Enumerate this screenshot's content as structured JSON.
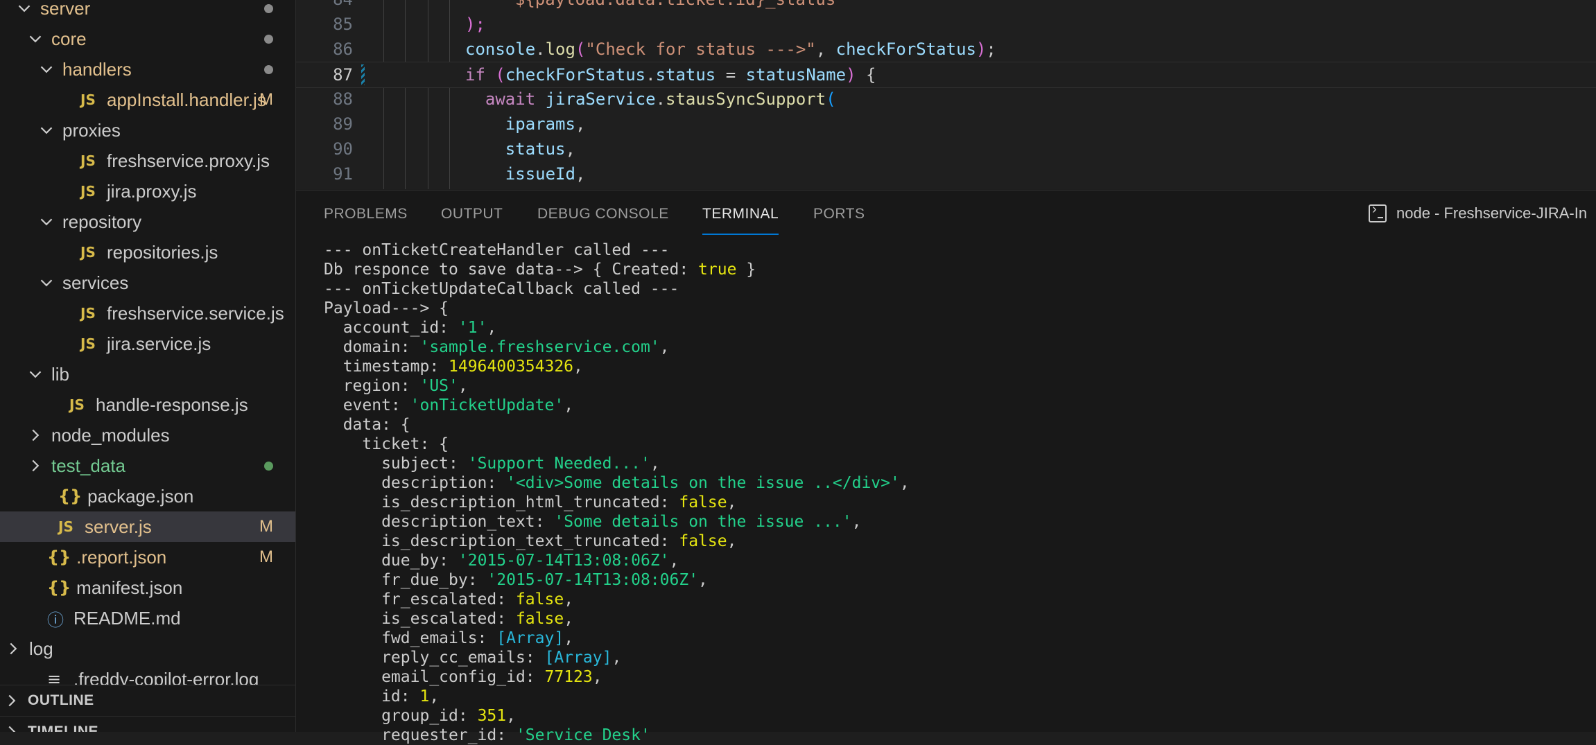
{
  "explorer": {
    "rows": [
      {
        "label": "server",
        "indent": 1,
        "chevron": "down",
        "icon": "",
        "color": "yellow",
        "mark": "dot-gray"
      },
      {
        "label": "core",
        "indent": 2,
        "chevron": "down",
        "icon": "",
        "color": "yellow",
        "mark": "dot-gray"
      },
      {
        "label": "handlers",
        "indent": 3,
        "chevron": "down",
        "icon": "",
        "color": "yellow",
        "mark": "dot-gray"
      },
      {
        "label": "appInstall.handler.js",
        "indent": 4,
        "chevron": "",
        "icon": "JS",
        "color": "yellow",
        "mark": "M"
      },
      {
        "label": "proxies",
        "indent": 3,
        "chevron": "down",
        "icon": "",
        "color": "",
        "mark": ""
      },
      {
        "label": "freshservice.proxy.js",
        "indent": 4,
        "chevron": "",
        "icon": "JS",
        "color": "",
        "mark": ""
      },
      {
        "label": "jira.proxy.js",
        "indent": 4,
        "chevron": "",
        "icon": "JS",
        "color": "",
        "mark": ""
      },
      {
        "label": "repository",
        "indent": 3,
        "chevron": "down",
        "icon": "",
        "color": "",
        "mark": ""
      },
      {
        "label": "repositories.js",
        "indent": 4,
        "chevron": "",
        "icon": "JS",
        "color": "",
        "mark": ""
      },
      {
        "label": "services",
        "indent": 3,
        "chevron": "down",
        "icon": "",
        "color": "",
        "mark": ""
      },
      {
        "label": "freshservice.service.js",
        "indent": 4,
        "chevron": "",
        "icon": "JS",
        "color": "",
        "mark": ""
      },
      {
        "label": "jira.service.js",
        "indent": 4,
        "chevron": "",
        "icon": "JS",
        "color": "",
        "mark": ""
      },
      {
        "label": "lib",
        "indent": 2,
        "chevron": "down",
        "icon": "",
        "color": "",
        "mark": ""
      },
      {
        "label": "handle-response.js",
        "indent": 3,
        "chevron": "",
        "icon": "JS",
        "color": "",
        "mark": ""
      },
      {
        "label": "node_modules",
        "indent": 2,
        "chevron": "right",
        "icon": "",
        "color": "",
        "mark": ""
      },
      {
        "label": "test_data",
        "indent": 2,
        "chevron": "right",
        "icon": "",
        "color": "green",
        "mark": "dot-green"
      },
      {
        "label": "package.json",
        "indent": 2,
        "chevron": "",
        "icon": "{}",
        "color": "",
        "mark": ""
      },
      {
        "label": "server.js",
        "indent": 2,
        "chevron": "",
        "icon": "JS",
        "color": "yellow",
        "mark": "M",
        "selected": true
      },
      {
        "label": ".report.json",
        "indent": 1,
        "chevron": "",
        "icon": "{}",
        "color": "yellow",
        "mark": "M"
      },
      {
        "label": "manifest.json",
        "indent": 1,
        "chevron": "",
        "icon": "{}",
        "color": "",
        "mark": ""
      },
      {
        "label": "README.md",
        "indent": 1,
        "chevron": "",
        "icon": "ⓘ",
        "color": "",
        "mark": ""
      },
      {
        "label": "log",
        "indent": 0,
        "chevron": "right",
        "icon": "",
        "color": "",
        "mark": ""
      },
      {
        "label": ".freddy-copilot-error.log",
        "indent": 1,
        "chevron": "",
        "icon": "≡",
        "color": "",
        "mark": ""
      }
    ],
    "outline_label": "OUTLINE",
    "timeline_label": "TIMELINE"
  },
  "editor": {
    "current_line": 87,
    "lines": [
      {
        "num": 84,
        "tokens": [
          [
            "tk-tmpl",
            "  ${payload.data.ticket.id}_status"
          ]
        ]
      },
      {
        "num": 85,
        "tokens": [
          [
            "tk-paren",
            ");"
          ]
        ]
      },
      {
        "num": 86,
        "tokens": [
          [
            "tk-var",
            "console"
          ],
          [
            "tk-punc",
            "."
          ],
          [
            "tk-fn",
            "log"
          ],
          [
            "tk-paren",
            "("
          ],
          [
            "tk-str",
            "\"Check for status --->\""
          ],
          [
            "tk-punc",
            ", "
          ],
          [
            "tk-var",
            "checkForStatus"
          ],
          [
            "tk-paren",
            ")"
          ],
          [
            "tk-punc",
            ";"
          ]
        ]
      },
      {
        "num": 87,
        "tokens": [
          [
            "tk-kw",
            "if"
          ],
          [
            "tk-punc",
            " "
          ],
          [
            "tk-paren",
            "("
          ],
          [
            "tk-var",
            "checkForStatus"
          ],
          [
            "tk-punc",
            "."
          ],
          [
            "tk-var",
            "status"
          ],
          [
            "tk-punc",
            " = "
          ],
          [
            "tk-var",
            "statusName"
          ],
          [
            "tk-paren",
            ")"
          ],
          [
            "tk-punc",
            " {"
          ]
        ]
      },
      {
        "num": 88,
        "tokens": [
          [
            "tk-punc",
            "  "
          ],
          [
            "tk-kw",
            "await"
          ],
          [
            "tk-punc",
            " "
          ],
          [
            "tk-var",
            "jiraService"
          ],
          [
            "tk-punc",
            "."
          ],
          [
            "tk-fn",
            "stausSyncSupport"
          ],
          [
            "tk-paren2",
            "("
          ]
        ]
      },
      {
        "num": 89,
        "tokens": [
          [
            "tk-punc",
            "    "
          ],
          [
            "tk-var",
            "iparams"
          ],
          [
            "tk-punc",
            ","
          ]
        ]
      },
      {
        "num": 90,
        "tokens": [
          [
            "tk-punc",
            "    "
          ],
          [
            "tk-var",
            "status"
          ],
          [
            "tk-punc",
            ","
          ]
        ]
      },
      {
        "num": 91,
        "tokens": [
          [
            "tk-punc",
            "    "
          ],
          [
            "tk-var",
            "issueId"
          ],
          [
            "tk-punc",
            ","
          ]
        ]
      }
    ]
  },
  "panel": {
    "tabs": [
      "PROBLEMS",
      "OUTPUT",
      "DEBUG CONSOLE",
      "TERMINAL",
      "PORTS"
    ],
    "active_tab": "TERMINAL",
    "terminal_title": "node - Freshservice-JIRA-In"
  },
  "terminal": {
    "lines": [
      [
        [
          "",
          "--- onTicketCreateHandler called ---"
        ]
      ],
      [
        [
          "",
          "Db responce to save data--> { Created: "
        ],
        [
          "t-bool",
          "true"
        ],
        [
          "",
          " }"
        ]
      ],
      [
        [
          "",
          "--- onTicketUpdateCallback called ---"
        ]
      ],
      [
        [
          "",
          "Payload---> {"
        ]
      ],
      [
        [
          "",
          "  account_id: "
        ],
        [
          "t-str",
          "'1'"
        ],
        [
          "",
          ","
        ]
      ],
      [
        [
          "",
          "  domain: "
        ],
        [
          "t-str",
          "'sample.freshservice.com'"
        ],
        [
          "",
          ","
        ]
      ],
      [
        [
          "",
          "  timestamp: "
        ],
        [
          "t-num",
          "1496400354326"
        ],
        [
          "",
          ","
        ]
      ],
      [
        [
          "",
          "  region: "
        ],
        [
          "t-str",
          "'US'"
        ],
        [
          "",
          ","
        ]
      ],
      [
        [
          "",
          "  event: "
        ],
        [
          "t-str",
          "'onTicketUpdate'"
        ],
        [
          "",
          ","
        ]
      ],
      [
        [
          "",
          "  data: {"
        ]
      ],
      [
        [
          "",
          "    ticket: {"
        ]
      ],
      [
        [
          "",
          "      subject: "
        ],
        [
          "t-str",
          "'Support Needed...'"
        ],
        [
          "",
          ","
        ]
      ],
      [
        [
          "",
          "      description: "
        ],
        [
          "t-str",
          "'<div>Some details on the issue ..</div>'"
        ],
        [
          "",
          ","
        ]
      ],
      [
        [
          "",
          "      is_description_html_truncated: "
        ],
        [
          "t-bool",
          "false"
        ],
        [
          "",
          ","
        ]
      ],
      [
        [
          "",
          "      description_text: "
        ],
        [
          "t-str",
          "'Some details on the issue ...'"
        ],
        [
          "",
          ","
        ]
      ],
      [
        [
          "",
          "      is_description_text_truncated: "
        ],
        [
          "t-bool",
          "false"
        ],
        [
          "",
          ","
        ]
      ],
      [
        [
          "",
          "      due_by: "
        ],
        [
          "t-str",
          "'2015-07-14T13:08:06Z'"
        ],
        [
          "",
          ","
        ]
      ],
      [
        [
          "",
          "      fr_due_by: "
        ],
        [
          "t-str",
          "'2015-07-14T13:08:06Z'"
        ],
        [
          "",
          ","
        ]
      ],
      [
        [
          "",
          "      fr_escalated: "
        ],
        [
          "t-bool",
          "false"
        ],
        [
          "",
          ","
        ]
      ],
      [
        [
          "",
          "      is_escalated: "
        ],
        [
          "t-bool",
          "false"
        ],
        [
          "",
          ","
        ]
      ],
      [
        [
          "",
          "      fwd_emails: "
        ],
        [
          "t-arr",
          "[Array]"
        ],
        [
          "",
          ","
        ]
      ],
      [
        [
          "",
          "      reply_cc_emails: "
        ],
        [
          "t-arr",
          "[Array]"
        ],
        [
          "",
          ","
        ]
      ],
      [
        [
          "",
          "      email_config_id: "
        ],
        [
          "t-num",
          "77123"
        ],
        [
          "",
          ","
        ]
      ],
      [
        [
          "",
          "      id: "
        ],
        [
          "t-num",
          "1"
        ],
        [
          "",
          ","
        ]
      ],
      [
        [
          "",
          "      group_id: "
        ],
        [
          "t-num",
          "351"
        ],
        [
          "",
          ","
        ]
      ],
      [
        [
          "",
          "      requester_id: "
        ],
        [
          "t-str",
          "'Service Desk'"
        ]
      ]
    ]
  },
  "colors": {
    "accent": "#0078d4",
    "modified": "#e2c08d",
    "untracked": "#73c991"
  }
}
